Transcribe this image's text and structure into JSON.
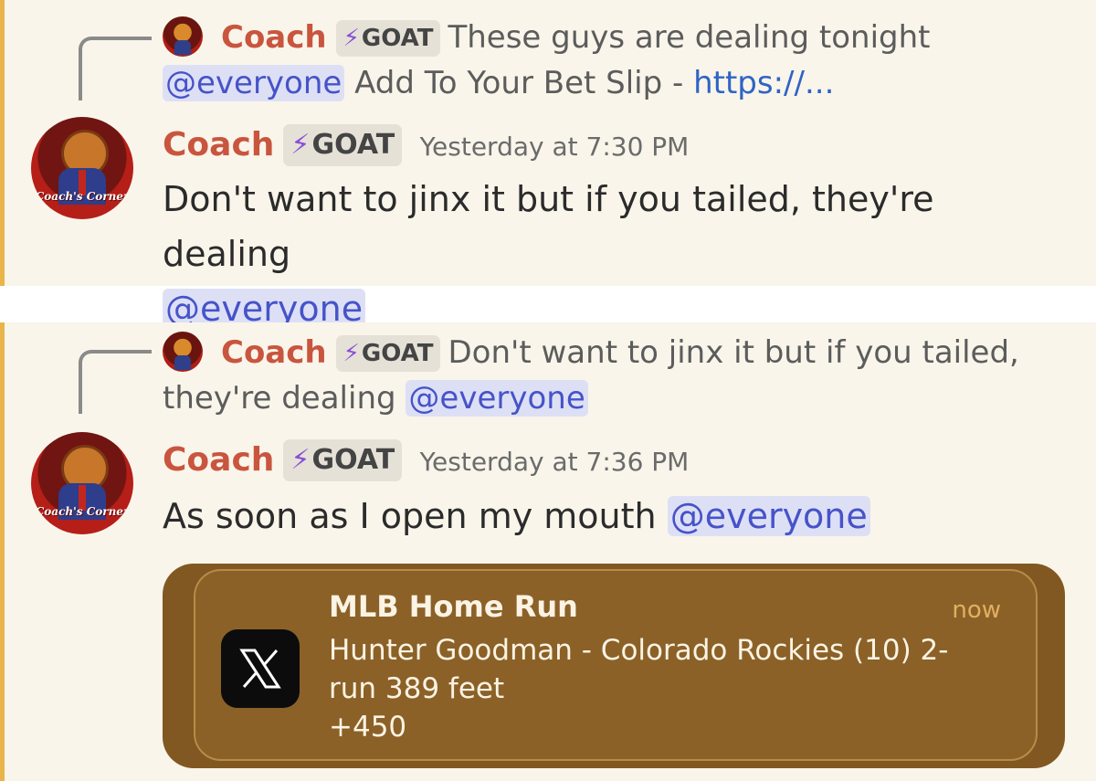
{
  "colors": {
    "accent_bar": "#e8b54a",
    "author": "#c9553f",
    "mention_text": "#4653c9",
    "mention_bg": "#dde0f5",
    "badge_bolt": "#8a4fd6",
    "link": "#2f64c5",
    "notification_bg": "#8b6128"
  },
  "icons": {
    "badge": "lightning-bolt-icon",
    "notification_app": "x-logo-icon"
  },
  "messages": [
    {
      "reply": {
        "author": "Coach",
        "badge": "GOAT",
        "text": "These guys are dealing tonight",
        "mention": "@everyone",
        "text_after": "Add To Your Bet Slip -",
        "link": "https://..."
      },
      "author": "Coach",
      "badge": "GOAT",
      "timestamp": "Yesterday at 7:30 PM",
      "avatar_text": "Coach's Corner",
      "body": "Don't want to jinx it but if you tailed, they're dealing",
      "mention": "@everyone"
    },
    {
      "reply": {
        "author": "Coach",
        "badge": "GOAT",
        "text": "Don't want to jinx it but if you tailed, they're dealing",
        "mention": "@everyone"
      },
      "author": "Coach",
      "badge": "GOAT",
      "timestamp": "Yesterday at 7:36 PM",
      "avatar_text": "Coach's Corner",
      "body": "As soon as I open my mouth",
      "mention": "@everyone",
      "notification": {
        "title": "MLB Home Run",
        "time": "now",
        "line1": "Hunter Goodman - Colorado Rockies (10) 2-run 389 feet",
        "line2": "+450"
      }
    }
  ]
}
